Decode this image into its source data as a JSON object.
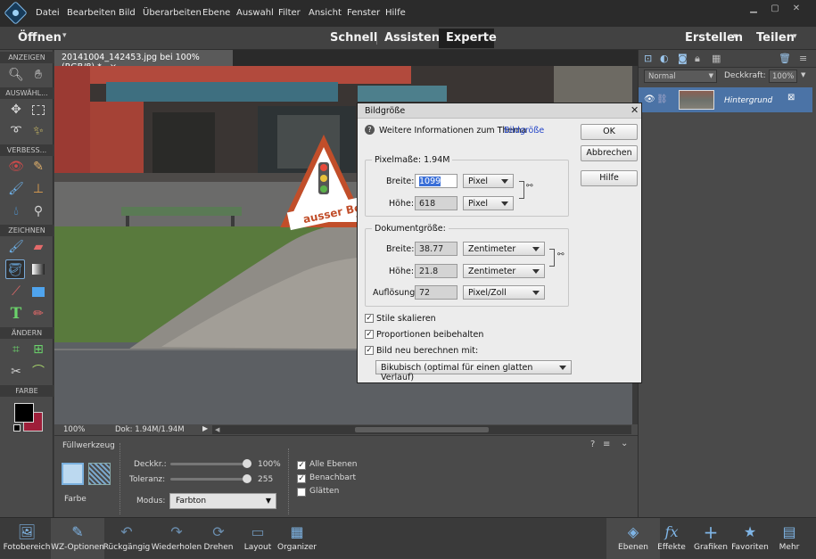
{
  "menubar": {
    "items": [
      "Datei",
      "Bearbeiten",
      "Bild",
      "Überarbeiten",
      "Ebene",
      "Auswahl",
      "Filter",
      "Ansicht",
      "Fenster",
      "Hilfe"
    ]
  },
  "modebar": {
    "open_label": "Öffnen",
    "modes": [
      "Schnell",
      "Assistent",
      "Experte"
    ],
    "active_mode": "Experte",
    "create_label": "Erstellen",
    "share_label": "Teilen"
  },
  "toolbox": {
    "sections": [
      "ANZEIGEN",
      "AUSWÄHL...",
      "VERBESS...",
      "ZEICHNEN",
      "ÄNDERN",
      "FARBE"
    ],
    "foreground_color": "#000000",
    "background_color": "#9e1f3a"
  },
  "document": {
    "tab_label": "20141004_142453.jpg bei 100% (RGB/8) *",
    "close_glyph": "×",
    "zoom": "100%",
    "doc_info": "Dok: 1.94M/1.94M",
    "sign_text": "ausser Betrie"
  },
  "layers_panel": {
    "blend_mode": "Normal",
    "opacity_label": "Deckkraft:",
    "opacity_value": "100%",
    "layer_name": "Hintergrund"
  },
  "tool_options": {
    "tool_name": "Füllwerkzeug",
    "fill_label": "Farbe",
    "opacity_label": "Deckkr.:",
    "opacity_value": "100%",
    "tolerance_label": "Toleranz:",
    "tolerance_value": "255",
    "mode_label": "Modus:",
    "mode_value": "Farbton",
    "checks": [
      {
        "label": "Alle Ebenen",
        "checked": true
      },
      {
        "label": "Benachbart",
        "checked": true
      },
      {
        "label": "Glätten",
        "checked": false
      }
    ]
  },
  "bottombar": {
    "items": [
      "Fotobereich",
      "WZ-Optionen",
      "Rückgängig",
      "Wiederholen",
      "Drehen",
      "Layout",
      "Organizer",
      "Ebenen",
      "Effekte",
      "Grafiken",
      "Favoriten",
      "Mehr"
    ]
  },
  "dialog": {
    "title": "Bildgröße",
    "close_glyph": "✕",
    "info_text": "Weitere Informationen zum Thema",
    "info_link": "Bildgröße",
    "ok_label": "OK",
    "cancel_label": "Abbrechen",
    "help_label": "Hilfe",
    "pixel_group_label": "Pixelmaße: 1.94M",
    "width_label": "Breite:",
    "width_value": "1099",
    "width_unit": "Pixel",
    "height_label": "Höhe:",
    "height_value": "618",
    "height_unit": "Pixel",
    "doc_group_label": "Dokumentgröße:",
    "doc_width_label": "Breite:",
    "doc_width_value": "38.77",
    "doc_width_unit": "Zentimeter",
    "doc_height_label": "Höhe:",
    "doc_height_value": "21.8",
    "doc_height_unit": "Zentimeter",
    "resolution_label": "Auflösung:",
    "resolution_value": "72",
    "resolution_unit": "Pixel/Zoll",
    "scale_styles_label": "Stile skalieren",
    "scale_styles_checked": true,
    "constrain_label": "Proportionen beibehalten",
    "constrain_checked": true,
    "resample_label": "Bild neu berechnen mit:",
    "resample_checked": true,
    "resample_method": "Bikubisch (optimal für einen glatten Verlauf)"
  }
}
